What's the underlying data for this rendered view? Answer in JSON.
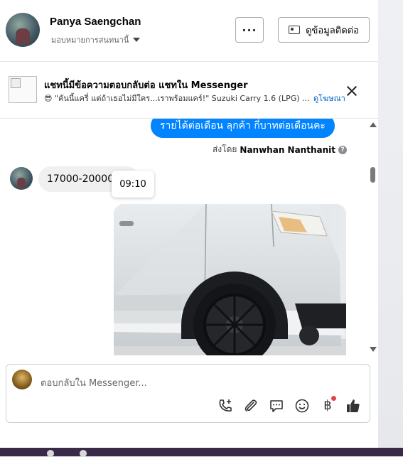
{
  "header": {
    "name": "Panya Saengchan",
    "assign_label": "มอบหมายการสนทนานี้",
    "more_label": "···",
    "info_button": "ดูข้อมูลติดต่อ"
  },
  "notice": {
    "title": "แชทนี้มีข้อความตอบกลับต่อ แชทใน Messenger",
    "subtitle": "😎 \"คันนี้แครี่ แต่ถ้าเธอไม่มีใคร...เราพร้อมแคร์!\" Suzuki Carry 1.6 (LPG) ...",
    "link": "ดูโฆษณา"
  },
  "chat": {
    "outgoing_text": "รายได้ต่อเดือน ลุกค้า กี่บาทต่อเดือนคะ",
    "sent_by_prefix": "ส่งโดย",
    "sent_by_name": "Nanwhan Nanthanit",
    "incoming_text": "17000-20000",
    "tooltip_time": "09:10"
  },
  "composer": {
    "placeholder": "ตอบกลับใน Messenger...",
    "currency_symbol": "฿"
  },
  "colors": {
    "accent": "#0084ff",
    "link": "#0064d1",
    "badge": "#e4414d"
  },
  "icons": [
    "phone-plus-icon",
    "paperclip-icon",
    "chat-bubble-icon",
    "smiley-icon",
    "baht-icon",
    "thumbs-up-icon"
  ]
}
